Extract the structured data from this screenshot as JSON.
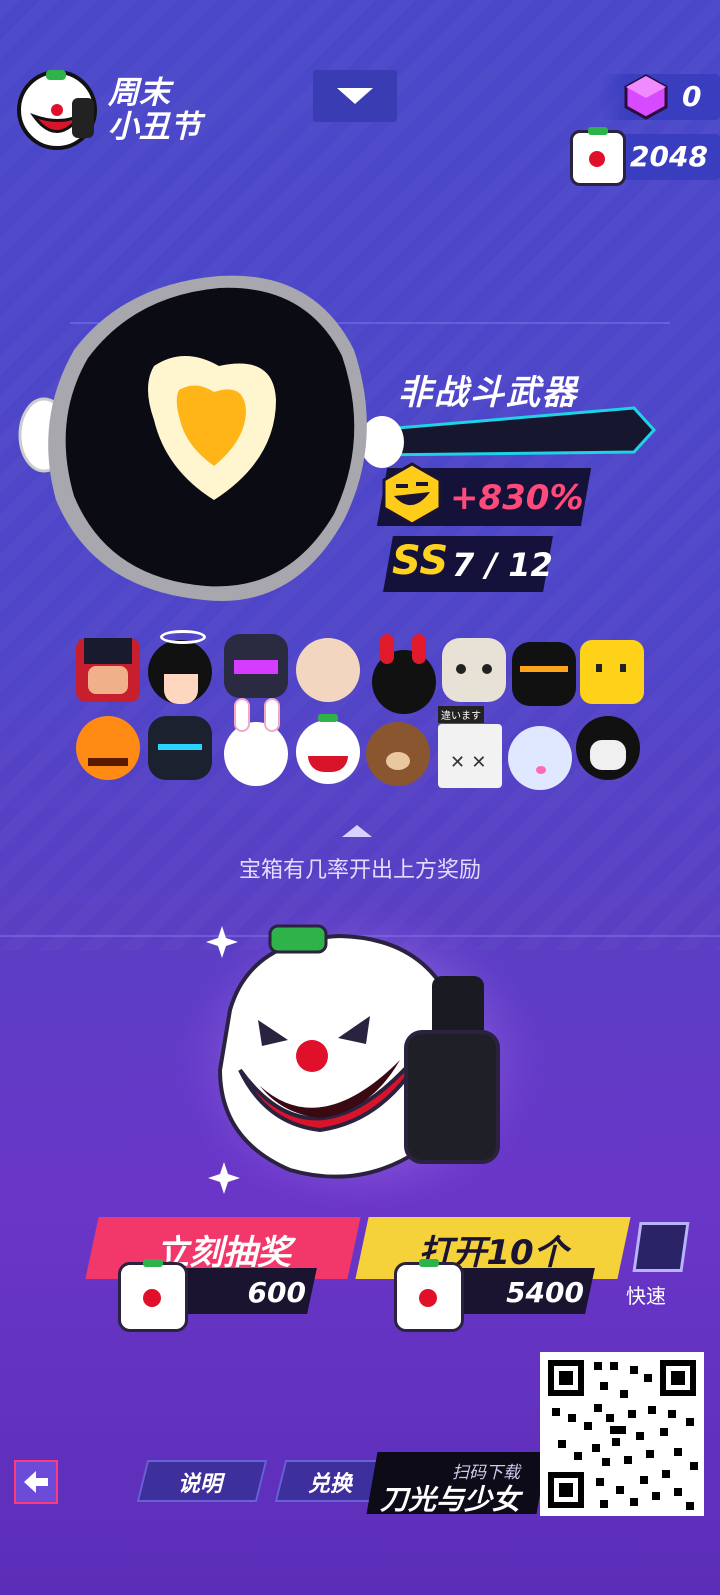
{
  "event": {
    "title_line1": "周末",
    "title_line2": "小丑节"
  },
  "currencies": {
    "gems": "0",
    "tickets": "2048"
  },
  "item": {
    "name": "非战斗武器",
    "bonus": "+830%",
    "rarity": "SS",
    "count": "7 / 12"
  },
  "rewards": {
    "row1": [
      "nutcracker-head",
      "halo-bob-head",
      "visor-helmet-head",
      "blonde-head",
      "red-bunny-ears-head",
      "ram-skull-head",
      "visor-gold-head",
      "yellow-block-head"
    ],
    "row2": [
      "pumpkin-head",
      "knight-helmet-head",
      "white-bunny-head",
      "clown-head",
      "bear-head",
      "box-head",
      "fish-head",
      "skull-hood-head"
    ],
    "box_tag": "違います"
  },
  "hint_text": "宝箱有几率开出上方奖励",
  "actions": {
    "draw_label": "立刻抽奖",
    "draw_price": "600",
    "ten_label": "打开10个",
    "ten_price": "5400",
    "quick_label": "快速"
  },
  "bottom": {
    "info_label": "说明",
    "exchange_label": "兑换",
    "promo_top": "扫码下载",
    "promo_main": "刀光与少女"
  },
  "colors": {
    "accent_pink": "#f2386a",
    "accent_yellow": "#f5d23a",
    "bonus_pink": "#ff4a7a",
    "rarity_gold": "#ffd21e"
  }
}
